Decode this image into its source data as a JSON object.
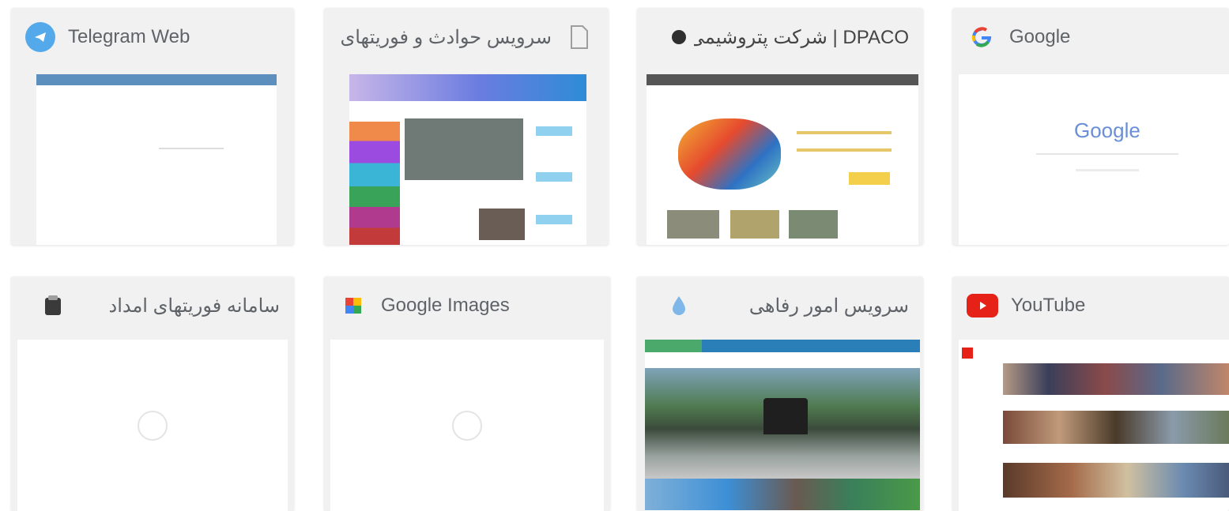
{
  "tiles": [
    {
      "title": "Telegram Web",
      "icon": "telegram-icon",
      "dir": "ltr"
    },
    {
      "title": "سرویس حوادث و فوریتهای",
      "icon": "page-icon",
      "dir": "rtl"
    },
    {
      "title": "DPACO | شرکت پتروشیمی",
      "icon": "dpaco-icon",
      "dir": "rtl"
    },
    {
      "title": "Google",
      "icon": "google-icon",
      "dir": "ltr"
    },
    {
      "title": "سامانه فوریتهای امداد",
      "icon": "site-icon",
      "dir": "rtl"
    },
    {
      "title": "Google Images",
      "icon": "google-images-icon",
      "dir": "ltr"
    },
    {
      "title": "سرویس امور رفاهی",
      "icon": "drop-icon",
      "dir": "rtl"
    },
    {
      "title": "YouTube",
      "icon": "youtube-icon",
      "dir": "ltr"
    }
  ],
  "google_logo": "Google",
  "colors": {
    "telegram": "#54a9eb",
    "youtube": "#e62117",
    "tile_bg": "#f1f1f1"
  }
}
